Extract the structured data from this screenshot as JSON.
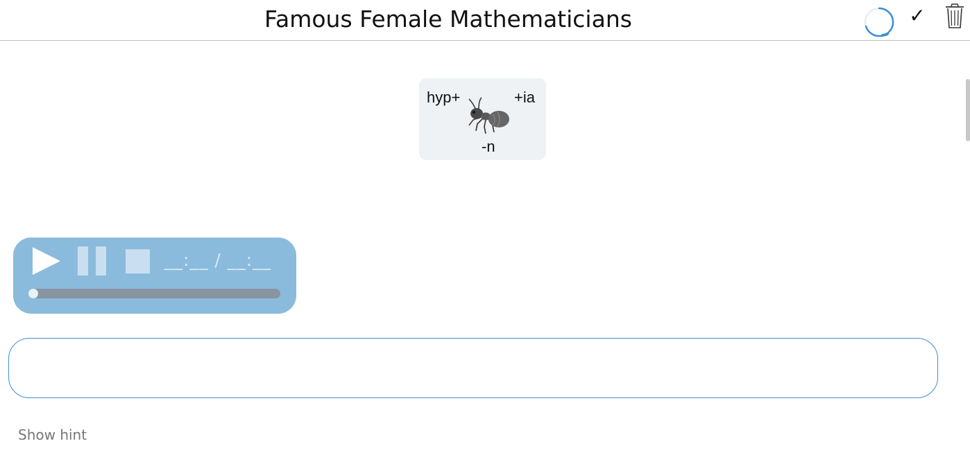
{
  "header": {
    "title": "Famous Female Mathematicians",
    "check_icon": "check-mark-icon",
    "check_glyph": "✓",
    "trash_icon": "trash-can-icon",
    "spinner_icon": "loading-spinner-icon",
    "accent_color": "#3a8fd4"
  },
  "puzzle": {
    "prefix": "hyp+",
    "suffix": "+ia",
    "under": "-n",
    "picture_icon": "ant-icon"
  },
  "player": {
    "play_icon": "play-icon",
    "pause_icon": "pause-icon",
    "stop_icon": "stop-icon",
    "time_display": "__:__ / __:__",
    "progress": 0,
    "background_color": "#8bbbdc"
  },
  "answer": {
    "value": "",
    "placeholder": ""
  },
  "hint": {
    "label": "Show hint"
  }
}
